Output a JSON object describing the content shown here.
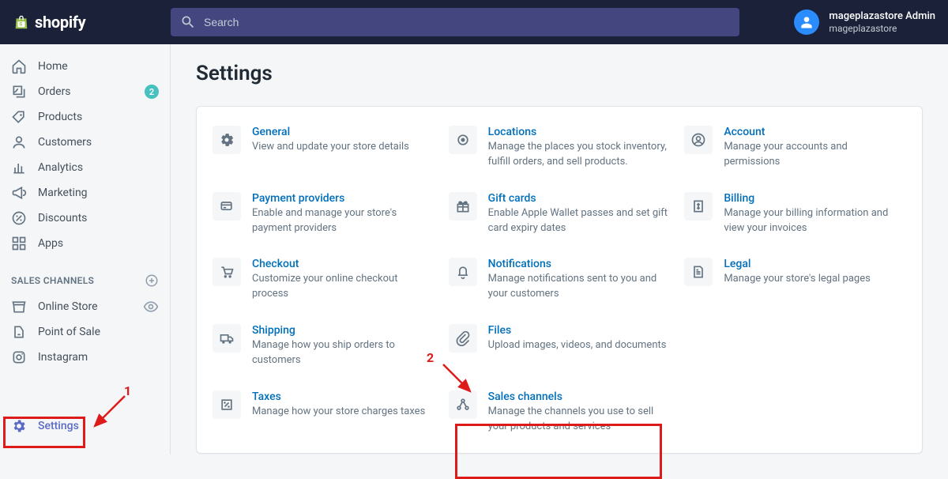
{
  "brand": {
    "name": "shopify"
  },
  "search": {
    "placeholder": "Search"
  },
  "account": {
    "name": "mageplazastore Admin",
    "store": "mageplazastore"
  },
  "sidebar": {
    "items": [
      {
        "label": "Home"
      },
      {
        "label": "Orders",
        "badge": "2"
      },
      {
        "label": "Products"
      },
      {
        "label": "Customers"
      },
      {
        "label": "Analytics"
      },
      {
        "label": "Marketing"
      },
      {
        "label": "Discounts"
      },
      {
        "label": "Apps"
      }
    ],
    "channels_header": "SALES CHANNELS",
    "channels": [
      {
        "label": "Online Store"
      },
      {
        "label": "Point of Sale"
      },
      {
        "label": "Instagram"
      }
    ],
    "settings_label": "Settings"
  },
  "page": {
    "title": "Settings"
  },
  "tiles": [
    {
      "title": "General",
      "desc": "View and update your store details"
    },
    {
      "title": "Locations",
      "desc": "Manage the places you stock inventory, fulfill orders, and sell products."
    },
    {
      "title": "Account",
      "desc": "Manage your accounts and permissions"
    },
    {
      "title": "Payment providers",
      "desc": "Enable and manage your store's payment providers"
    },
    {
      "title": "Gift cards",
      "desc": "Enable Apple Wallet passes and set gift card expiry dates"
    },
    {
      "title": "Billing",
      "desc": "Manage your billing information and view your invoices"
    },
    {
      "title": "Checkout",
      "desc": "Customize your online checkout process"
    },
    {
      "title": "Notifications",
      "desc": "Manage notifications sent to you and your customers"
    },
    {
      "title": "Legal",
      "desc": "Manage your store's legal pages"
    },
    {
      "title": "Shipping",
      "desc": "Manage how you ship orders to customers"
    },
    {
      "title": "Files",
      "desc": "Upload images, videos, and documents"
    },
    {
      "title": "Taxes",
      "desc": "Manage how your store charges taxes"
    },
    {
      "title": "Sales channels",
      "desc": "Manage the channels you use to sell your products and services"
    }
  ],
  "annotations": {
    "num1": "1",
    "num2": "2"
  }
}
